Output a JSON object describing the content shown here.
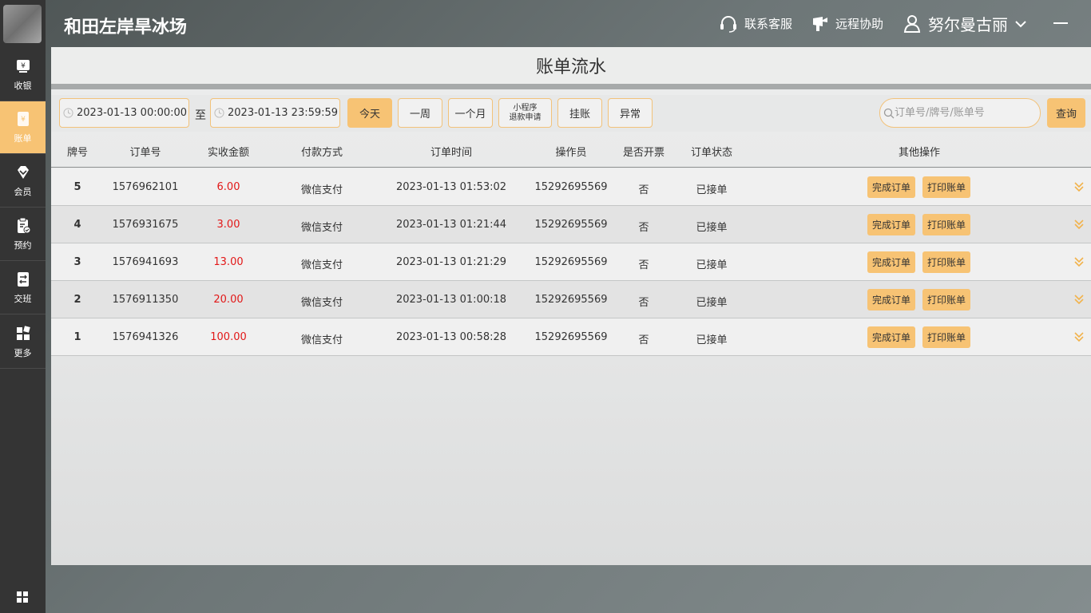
{
  "app": {
    "title": "和田左岸旱冰场"
  },
  "header": {
    "support_label": "联系客服",
    "remote_label": "远程协助",
    "user_name": "努尔曼古丽"
  },
  "sidebar": {
    "items": [
      {
        "key": "cashier",
        "label": "收银",
        "icon": "cash-register-icon"
      },
      {
        "key": "bills",
        "label": "账单",
        "icon": "bill-icon",
        "active": true
      },
      {
        "key": "members",
        "label": "会员",
        "icon": "diamond-icon"
      },
      {
        "key": "booking",
        "label": "预约",
        "icon": "clipboard-check-icon"
      },
      {
        "key": "shift",
        "label": "交班",
        "icon": "shift-handover-icon"
      },
      {
        "key": "more",
        "label": "更多",
        "icon": "grid-more-icon"
      }
    ]
  },
  "page": {
    "title": "账单流水"
  },
  "filters": {
    "start_date": "2023-01-13 00:00:00",
    "to_label": "至",
    "end_date": "2023-01-13 23:59:59",
    "buttons": {
      "today": "今天",
      "week": "一周",
      "month": "一个月",
      "refund_line1": "小程序",
      "refund_line2": "退款申请",
      "credit": "挂账",
      "abnormal": "异常"
    },
    "search_placeholder": "订单号/牌号/账单号",
    "query_label": "查询"
  },
  "table": {
    "headers": {
      "tag": "牌号",
      "order_no": "订单号",
      "amount": "实收金额",
      "payment": "付款方式",
      "time": "订单时间",
      "operator": "操作员",
      "invoice": "是否开票",
      "status": "订单状态",
      "actions": "其他操作"
    },
    "action_labels": {
      "complete": "完成订单",
      "print": "打印账单"
    },
    "rows": [
      {
        "tag": "5",
        "order_no": "1576962101",
        "amount": "6.00",
        "payment": "微信支付",
        "time": "2023-01-13 01:53:02",
        "operator": "15292695569",
        "invoice": "否",
        "status": "已接单"
      },
      {
        "tag": "4",
        "order_no": "1576931675",
        "amount": "3.00",
        "payment": "微信支付",
        "time": "2023-01-13 01:21:44",
        "operator": "15292695569",
        "invoice": "否",
        "status": "已接单"
      },
      {
        "tag": "3",
        "order_no": "1576941693",
        "amount": "13.00",
        "payment": "微信支付",
        "time": "2023-01-13 01:21:29",
        "operator": "15292695569",
        "invoice": "否",
        "status": "已接单"
      },
      {
        "tag": "2",
        "order_no": "1576911350",
        "amount": "20.00",
        "payment": "微信支付",
        "time": "2023-01-13 01:00:18",
        "operator": "15292695569",
        "invoice": "否",
        "status": "已接单"
      },
      {
        "tag": "1",
        "order_no": "1576941326",
        "amount": "100.00",
        "payment": "微信支付",
        "time": "2023-01-13 00:58:28",
        "operator": "15292695569",
        "invoice": "否",
        "status": "已接单"
      }
    ]
  },
  "colors": {
    "accent": "#f7c374",
    "amount": "#e21818",
    "sidebar_bg": "#343434"
  }
}
